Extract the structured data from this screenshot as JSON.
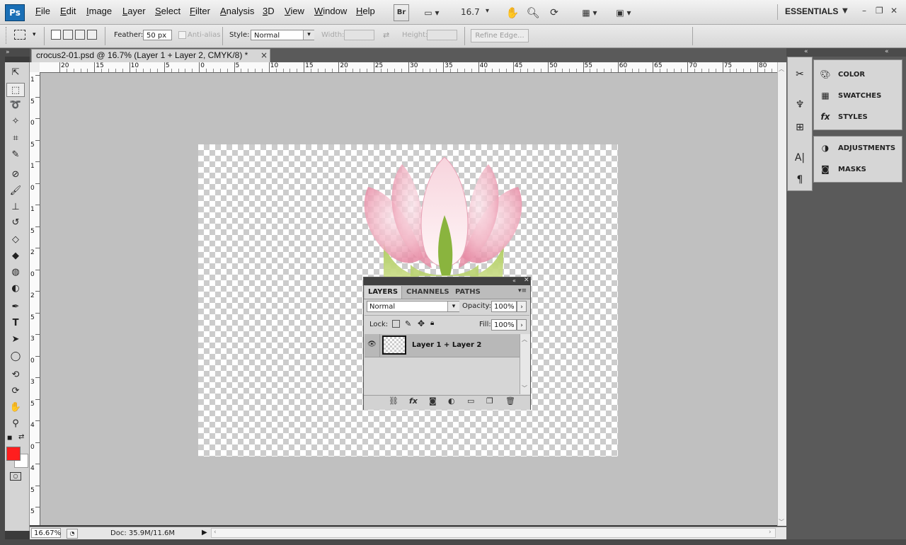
{
  "menubar": {
    "logo": "Ps",
    "items": [
      "File",
      "Edit",
      "Image",
      "Layer",
      "Select",
      "Filter",
      "Analysis",
      "3D",
      "View",
      "Window",
      "Help"
    ],
    "bridge_label": "Br",
    "zoom_value": "16.7",
    "workspace": "ESSENTIALS"
  },
  "options_bar": {
    "feather_label": "Feather:",
    "feather_value": "50 px",
    "antialias_label": "Anti-alias",
    "style_label": "Style:",
    "style_value": "Normal",
    "width_label": "Width:",
    "height_label": "Height:",
    "refine_edge_label": "Refine Edge..."
  },
  "document": {
    "tab_title": "crocus2-01.psd @ 16.7% (Layer 1 + Layer 2, CMYK/8) *",
    "close_glyph": "×",
    "ruler_top_labels": [
      "20",
      "15",
      "10",
      "5",
      "0",
      "5",
      "10",
      "15",
      "20",
      "25",
      "30",
      "35",
      "40",
      "45",
      "50",
      "55",
      "60",
      "65",
      "70",
      "75",
      "80"
    ],
    "ruler_left_labels": [
      "1",
      "5",
      "0",
      "5",
      "1",
      "0",
      "1",
      "5",
      "2",
      "0",
      "2",
      "5",
      "3",
      "0",
      "3",
      "5",
      "4",
      "0",
      "4",
      "5",
      "5"
    ],
    "zoom_percent": "16.67%",
    "doc_info": "Doc: 35.9M/11.6M"
  },
  "layers_panel": {
    "tabs": [
      "LAYERS",
      "CHANNELS",
      "PATHS"
    ],
    "blend_mode": "Normal",
    "opacity_label": "Opacity:",
    "opacity_value": "100%",
    "lock_label": "Lock:",
    "fill_label": "Fill:",
    "fill_value": "100%",
    "layer_name": "Layer 1 + Layer 2"
  },
  "right_panels": {
    "group1": [
      "COLOR",
      "SWATCHES",
      "STYLES"
    ],
    "group2": [
      "ADJUSTMENTS",
      "MASKS"
    ]
  },
  "colors": {
    "foreground": "#ff1e1e",
    "background": "#ffffff",
    "canvas_bg": "#c0c0c0"
  }
}
